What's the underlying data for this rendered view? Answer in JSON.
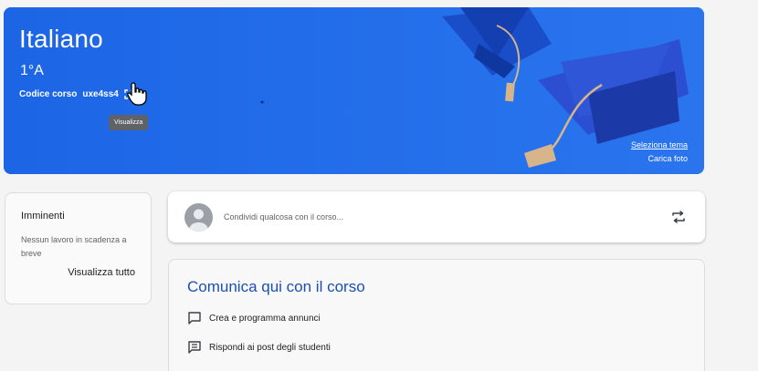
{
  "banner": {
    "title": "Italiano",
    "section": "1°A",
    "code_label": "Codice corso",
    "code_value": "uxe4ss4",
    "tooltip": "Visualizza",
    "select_theme": "Seleziona tema",
    "upload_photo": "Carica foto",
    "background_color": "#1e6ae8"
  },
  "upcoming": {
    "title": "Imminenti",
    "empty_text": "Nessun lavoro in scadenza a breve",
    "view_all": "Visualizza tutto"
  },
  "share": {
    "placeholder": "Condividi qualcosa con il corso...",
    "icons": [
      "avatar-icon",
      "repost-icon"
    ]
  },
  "communicate": {
    "title": "Comunica qui con il corso",
    "items": [
      {
        "label": "Crea e programma annunci",
        "icon": "chat-bubble-icon"
      },
      {
        "label": "Rispondi ai post degli studenti",
        "icon": "comment-list-icon"
      }
    ]
  },
  "colors": {
    "accent_title": "#1a4fb5",
    "banner": "#1e6ae8"
  }
}
